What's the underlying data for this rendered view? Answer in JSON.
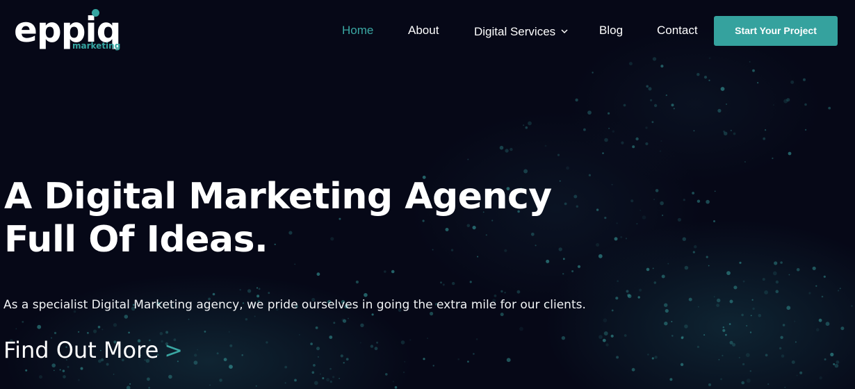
{
  "logo": {
    "word": "eppiq",
    "sub": "marketing",
    "accent_color": "#35a6a2"
  },
  "nav": {
    "items": [
      {
        "label": "Home",
        "active": true
      },
      {
        "label": "About",
        "active": false
      },
      {
        "label": "Digital Services",
        "active": false,
        "icon": "chevron-down-icon"
      },
      {
        "label": "Blog",
        "active": false
      },
      {
        "label": "Contact",
        "active": false
      }
    ],
    "cta_label": "Start Your Project",
    "cta_color": "#35a29e"
  },
  "hero": {
    "title_line1": "A Digital Marketing Agency",
    "title_line2": "Full Of Ideas.",
    "subtitle": "As a specialist Digital Marketing agency, we pride ourselves in going the extra mile for our clients.",
    "link_label": "Find Out More",
    "link_arrow": ">"
  },
  "theme": {
    "background": "#060817",
    "accent": "#3aa7a3"
  }
}
